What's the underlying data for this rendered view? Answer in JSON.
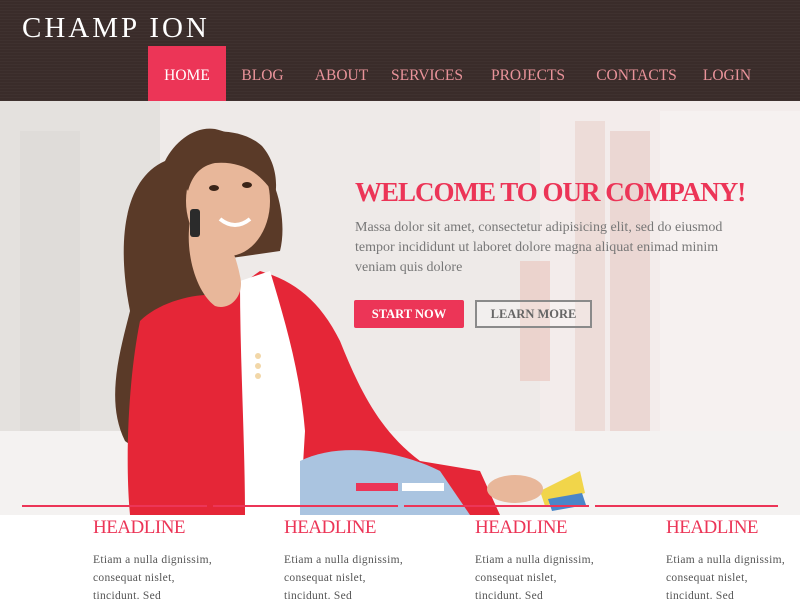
{
  "brand": {
    "logo": "CHAMP ION"
  },
  "nav": {
    "items": [
      {
        "label": "HOME",
        "active": true
      },
      {
        "label": "BLOG",
        "active": false
      },
      {
        "label": "ABOUT",
        "active": false
      },
      {
        "label": "SERVICES",
        "active": false
      },
      {
        "label": "PROJECTS",
        "active": false
      },
      {
        "label": "CONTACTS",
        "active": false
      },
      {
        "label": "LOGIN",
        "active": false
      }
    ]
  },
  "hero": {
    "title": "WELCOME TO OUR COMPANY!",
    "text": "Massa dolor sit amet, consectetur adipisicing elit, sed do eiusmod tempor incididunt ut laboret dolore magna aliquat enimad minim veniam quis dolore",
    "start_label": "START NOW",
    "learn_label": "LEARN MORE",
    "slider": {
      "slide_count": 2,
      "active_index": 0
    }
  },
  "features": [
    {
      "headline": "HEADLINE",
      "text": "Etiam a nulla dignissim, consequat nislet, tincidunt. Sed"
    },
    {
      "headline": "HEADLINE",
      "text": "Etiam a nulla dignissim, consequat nislet, tincidunt. Sed"
    },
    {
      "headline": "HEADLINE",
      "text": "Etiam a nulla dignissim, consequat nislet, tincidunt. Sed"
    },
    {
      "headline": "HEADLINE",
      "text": "Etiam a nulla dignissim, consequat nislet, tincidunt. Sed"
    }
  ],
  "colors": {
    "accent": "#ec3557",
    "header_bg": "#3a2c2a",
    "nav_text": "#e9939a",
    "body_text": "#777777"
  }
}
